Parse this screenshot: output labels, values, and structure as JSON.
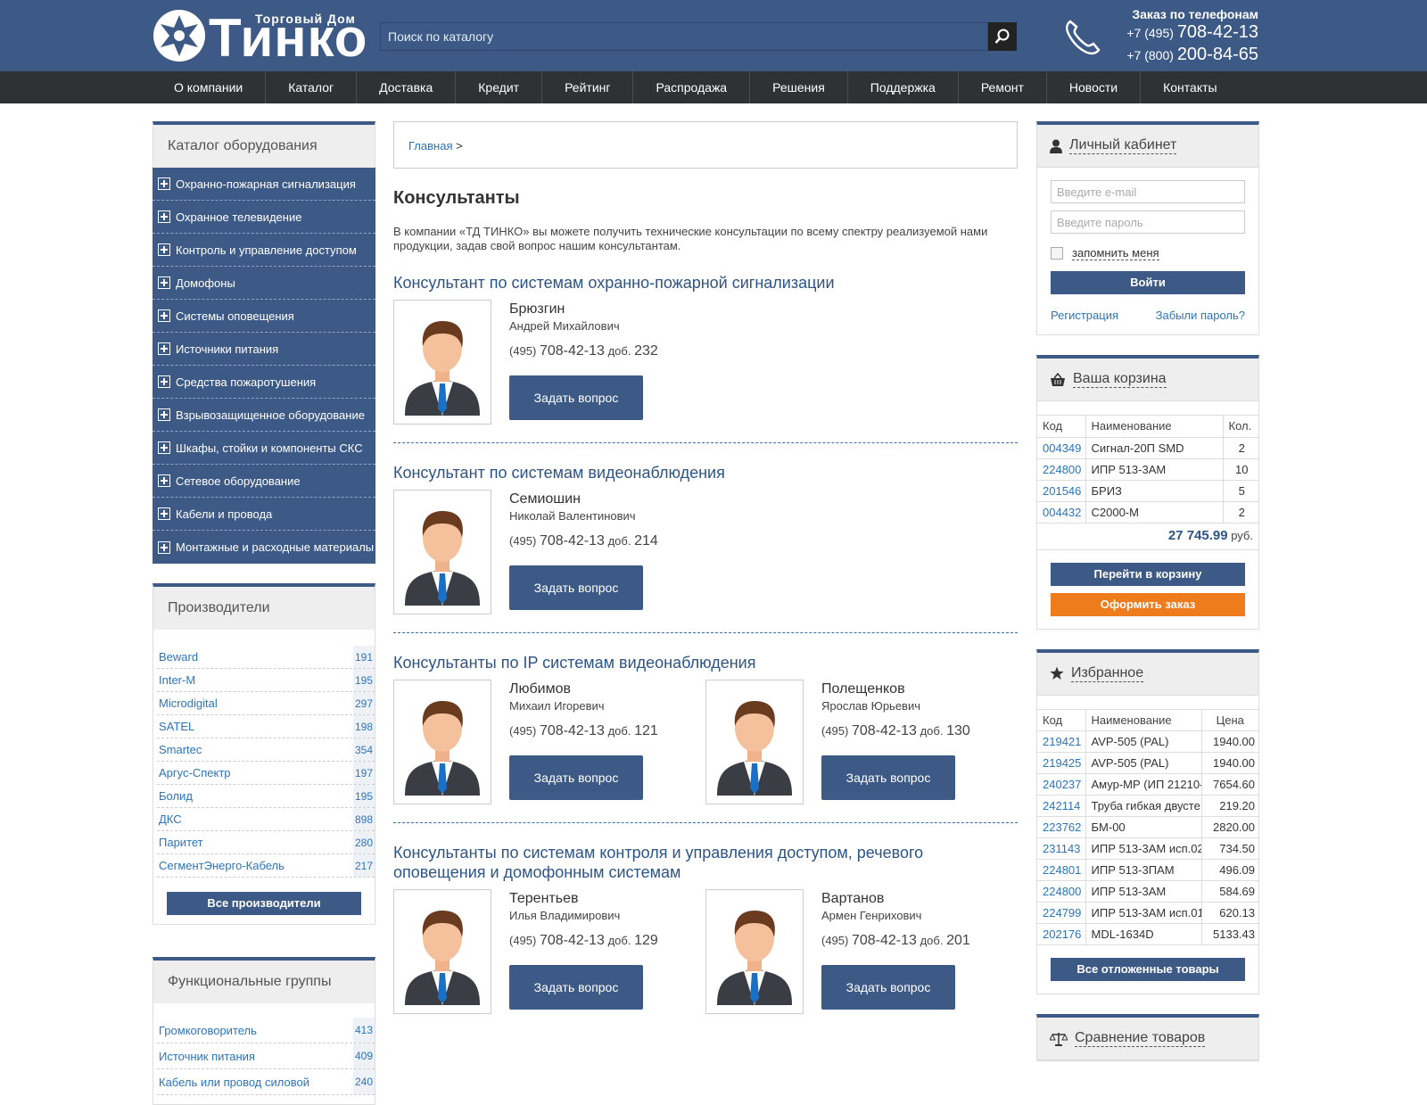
{
  "header": {
    "logo_small": "Торговый Дом",
    "logo_big": "Тинко",
    "search_placeholder": "Поиск по каталогу",
    "phone_title": "Заказ по телефонам",
    "phone1_code": "+7 (495)",
    "phone1_num": "708-42-13",
    "phone2_code": "+7 (800)",
    "phone2_num": "200-84-65"
  },
  "nav": [
    "О компании",
    "Каталог",
    "Доставка",
    "Кредит",
    "Рейтинг",
    "Распродажа",
    "Решения",
    "Поддержка",
    "Ремонт",
    "Новости",
    "Контакты"
  ],
  "catalog": {
    "title": "Каталог оборудования",
    "items": [
      "Охранно-пожарная сигнализация",
      "Охранное телевидение",
      "Контроль и управление доступом",
      "Домофоны",
      "Системы оповещения",
      "Источники питания",
      "Средства пожаротушения",
      "Взрывозащищенное оборудование",
      "Шкафы, стойки и компоненты СКС",
      "Сетевое оборудование",
      "Кабели и провода",
      "Монтажные и расходные материалы"
    ]
  },
  "manufacturers": {
    "title": "Производители",
    "items": [
      {
        "name": "Beward",
        "count": "191"
      },
      {
        "name": "Inter-M",
        "count": "195"
      },
      {
        "name": "Microdigital",
        "count": "297"
      },
      {
        "name": "SATEL",
        "count": "198"
      },
      {
        "name": "Smartec",
        "count": "354"
      },
      {
        "name": "Аргус-Спектр",
        "count": "197"
      },
      {
        "name": "Болид",
        "count": "195"
      },
      {
        "name": "ДКС",
        "count": "898"
      },
      {
        "name": "Паритет",
        "count": "280"
      },
      {
        "name": "СегментЭнерго-Кабель",
        "count": "217"
      }
    ],
    "all_button": "Все производители"
  },
  "groups": {
    "title": "Функциональные группы",
    "items": [
      {
        "name": "Громкоговоритель",
        "count": "413"
      },
      {
        "name": "Источник питания",
        "count": "409"
      },
      {
        "name": "Кабель или провод силовой",
        "count": "240"
      }
    ]
  },
  "main": {
    "breadcrumb": "Главная",
    "breadcrumb_sep": ">",
    "title": "Консультанты",
    "intro": "В компании «ТД ТИНКО» вы можете получить технические консультации по всему спектру реализуемой нами продукции, задав свой вопрос нашим консультантам.",
    "ask_label": "Задать вопрос",
    "phone_prefix": "(495)",
    "phone_num": "708-42-13",
    "ext_label": "доб.",
    "sections": [
      {
        "title": "Консультант по системам охранно-пожарной сигнализации",
        "people": [
          {
            "last": "Брюзгин",
            "first": "Андрей Михайлович",
            "ext": "232"
          }
        ]
      },
      {
        "title": "Консультант по системам видеонаблюдения",
        "people": [
          {
            "last": "Семиошин",
            "first": "Николай Валентинович",
            "ext": "214"
          }
        ]
      },
      {
        "title": "Консультанты по IP системам видеонаблюдения",
        "people": [
          {
            "last": "Любимов",
            "first": "Михаил Игоревич",
            "ext": "121"
          },
          {
            "last": "Полещенков",
            "first": "Ярослав Юрьевич",
            "ext": "130"
          }
        ]
      },
      {
        "title": "Консультанты по системам контроля и управления доступом, речевого оповещения и домофонным системам",
        "people": [
          {
            "last": "Терентьев",
            "first": "Илья Владимирович",
            "ext": "129"
          },
          {
            "last": "Вартанов",
            "first": "Армен Генрихович",
            "ext": "201"
          }
        ]
      }
    ]
  },
  "account": {
    "title": "Личный кабинет",
    "email_placeholder": "Введите e-mail",
    "password_placeholder": "Введите пароль",
    "remember": "запомнить меня",
    "login": "Войти",
    "register": "Регистрация",
    "forgot": "Забыли пароль?"
  },
  "cart": {
    "title": "Ваша корзина",
    "col_code": "Код",
    "col_name": "Наименование",
    "col_qty": "Кол.",
    "rows": [
      {
        "code": "004349",
        "name": "Сигнал-20П SMD",
        "qty": "2"
      },
      {
        "code": "224800",
        "name": "ИПР 513-3АМ",
        "qty": "10"
      },
      {
        "code": "201546",
        "name": "БРИЗ",
        "qty": "5"
      },
      {
        "code": "004432",
        "name": "С2000-М",
        "qty": "2"
      }
    ],
    "total": "27 745.99",
    "currency": "руб.",
    "goto_cart": "Перейти в корзину",
    "checkout": "Оформить заказ"
  },
  "favorites": {
    "title": "Избранное",
    "col_code": "Код",
    "col_name": "Наименование",
    "col_price": "Цена",
    "rows": [
      {
        "code": "219421",
        "name": "AVP-505 (PAL)",
        "price": "1940.00"
      },
      {
        "code": "219425",
        "name": "AVP-505 (PAL)",
        "price": "1940.00"
      },
      {
        "code": "240237",
        "name": "Амур-МР (ИП 21210-",
        "price": "7654.60"
      },
      {
        "code": "242114",
        "name": "Труба гибкая двусте",
        "price": "219.20"
      },
      {
        "code": "223762",
        "name": "БМ-00",
        "price": "2820.00"
      },
      {
        "code": "231143",
        "name": "ИПР 513-3АМ исп.02",
        "price": "734.50"
      },
      {
        "code": "224801",
        "name": "ИПР 513-3ПАМ",
        "price": "496.09"
      },
      {
        "code": "224800",
        "name": "ИПР 513-3АМ",
        "price": "584.69"
      },
      {
        "code": "224799",
        "name": "ИПР 513-3АМ исп.01",
        "price": "620.13"
      },
      {
        "code": "202176",
        "name": "MDL-1634D",
        "price": "5133.43"
      }
    ],
    "all_button": "Все отложенные товары"
  },
  "compare": {
    "title": "Сравнение товаров"
  },
  "colors": {
    "brand": "#3d5a86",
    "nav": "#2f3133",
    "link": "#2d74b8",
    "orange": "#ee7b1c"
  }
}
